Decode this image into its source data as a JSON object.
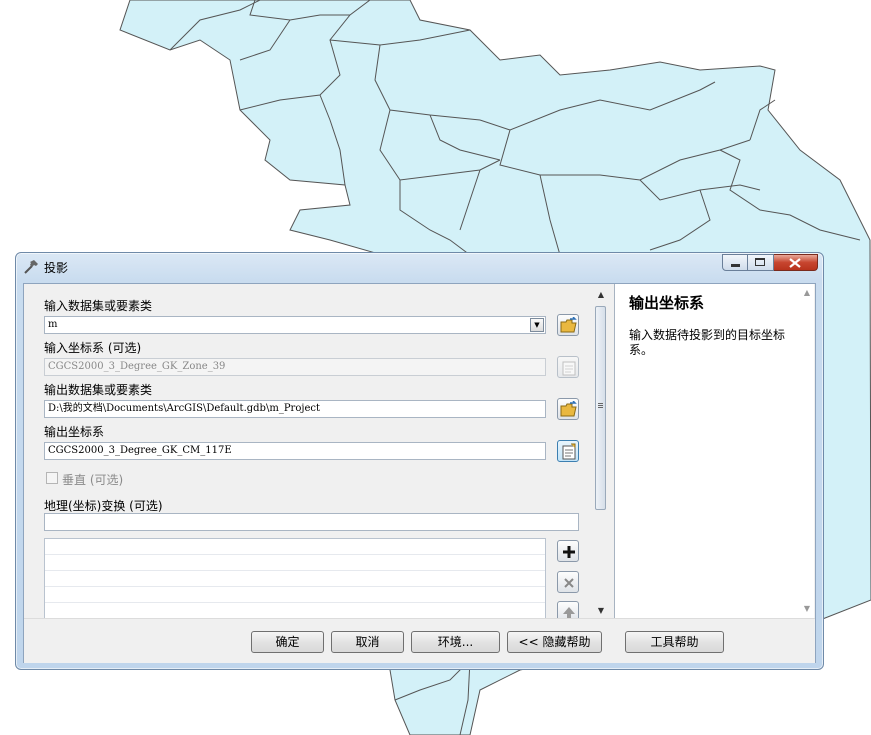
{
  "window": {
    "title": "投影",
    "icons": {
      "tool": "hammer-icon",
      "minimize": "minimize-icon",
      "maximize": "maximize-icon",
      "close": "close-icon"
    }
  },
  "form": {
    "input_dataset_label": "输入数据集或要素类",
    "input_dataset_value": "m",
    "input_crs_label": "输入坐标系 (可选)",
    "input_crs_value": "CGCS2000_3_Degree_GK_Zone_39",
    "output_dataset_label": "输出数据集或要素类",
    "output_dataset_value": "D:\\我的文档\\Documents\\ArcGIS\\Default.gdb\\m_Project",
    "output_crs_label": "输出坐标系",
    "output_crs_value": "CGCS2000_3_Degree_GK_CM_117E",
    "vertical_label": "垂直 (可选)",
    "geo_transform_label": "地理(坐标)变换 (可选)"
  },
  "help": {
    "title": "输出坐标系",
    "body": "输入数据待投影到的目标坐标系。"
  },
  "buttons": {
    "ok": "确定",
    "cancel": "取消",
    "environments": "环境...",
    "hide_help": "<< 隐藏帮助",
    "tool_help": "工具帮助"
  },
  "colors": {
    "map_fill": "#d3f1f8",
    "map_stroke": "#555555",
    "accent": "#3c7fb1"
  }
}
